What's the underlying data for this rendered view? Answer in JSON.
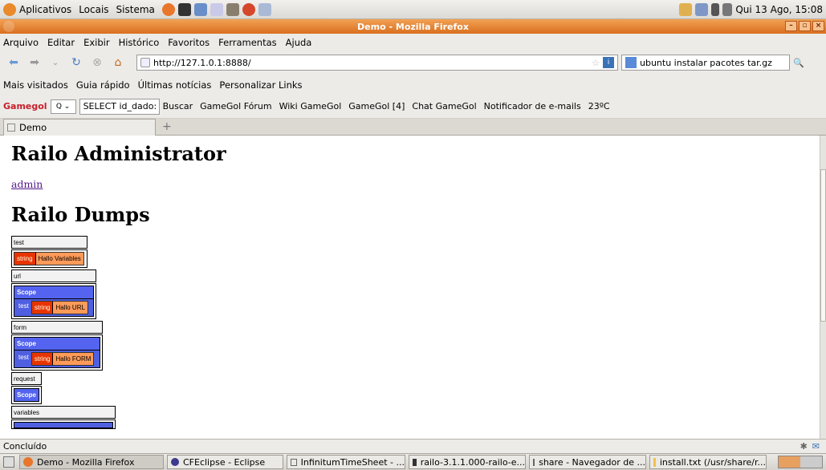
{
  "gnome_panel": {
    "menus": [
      "Aplicativos",
      "Locais",
      "Sistema"
    ],
    "clock": "Qui 13 Ago, 15:08"
  },
  "window": {
    "title": "Demo - Mozilla Firefox"
  },
  "menubar": [
    "Arquivo",
    "Editar",
    "Exibir",
    "Histórico",
    "Favoritos",
    "Ferramentas",
    "Ajuda"
  ],
  "navbar": {
    "url": "http://127.1.0.1:8888/",
    "search_value": "ubuntu instalar pacotes tar.gz"
  },
  "bookmarks": [
    "Mais visitados",
    "Guia rápido",
    "Últimas notícias",
    "Personalizar Links"
  ],
  "gamegol_toolbar": {
    "logo": "Gamegol",
    "select_value": "SELECT id_dado:",
    "items": [
      "Buscar",
      "GameGol Fórum",
      "Wiki GameGol",
      "GameGol [4]",
      "Chat GameGol",
      "Notificador de e-mails",
      "23ºC"
    ]
  },
  "tabs": [
    {
      "label": "Demo"
    }
  ],
  "page": {
    "title": "Railo Administrator",
    "admin_link": "admin",
    "dumps_title": "Railo Dumps",
    "dumps": [
      {
        "key": "test",
        "kind": "string",
        "type_label": "string",
        "value": "Hallo Variables"
      },
      {
        "key": "url",
        "kind": "scope",
        "scope_label": "Scope",
        "inner_key": "test",
        "type_label": "string",
        "value": "Hallo URL"
      },
      {
        "key": "form",
        "kind": "scope",
        "scope_label": "Scope",
        "inner_key": "test",
        "type_label": "string",
        "value": "Hallo FORM"
      },
      {
        "key": "request",
        "kind": "scope-empty",
        "scope_label": "Scope"
      },
      {
        "key": "variables"
      }
    ]
  },
  "status": "Concluído",
  "taskbar": [
    "Demo - Mozilla Firefox",
    "CFEclipse - Eclipse",
    "InfinitumTimeSheet - ...",
    "railo-3.1.1.000-railo-e...",
    "share - Navegador de ...",
    "install.txt (/usr/share/r..."
  ]
}
